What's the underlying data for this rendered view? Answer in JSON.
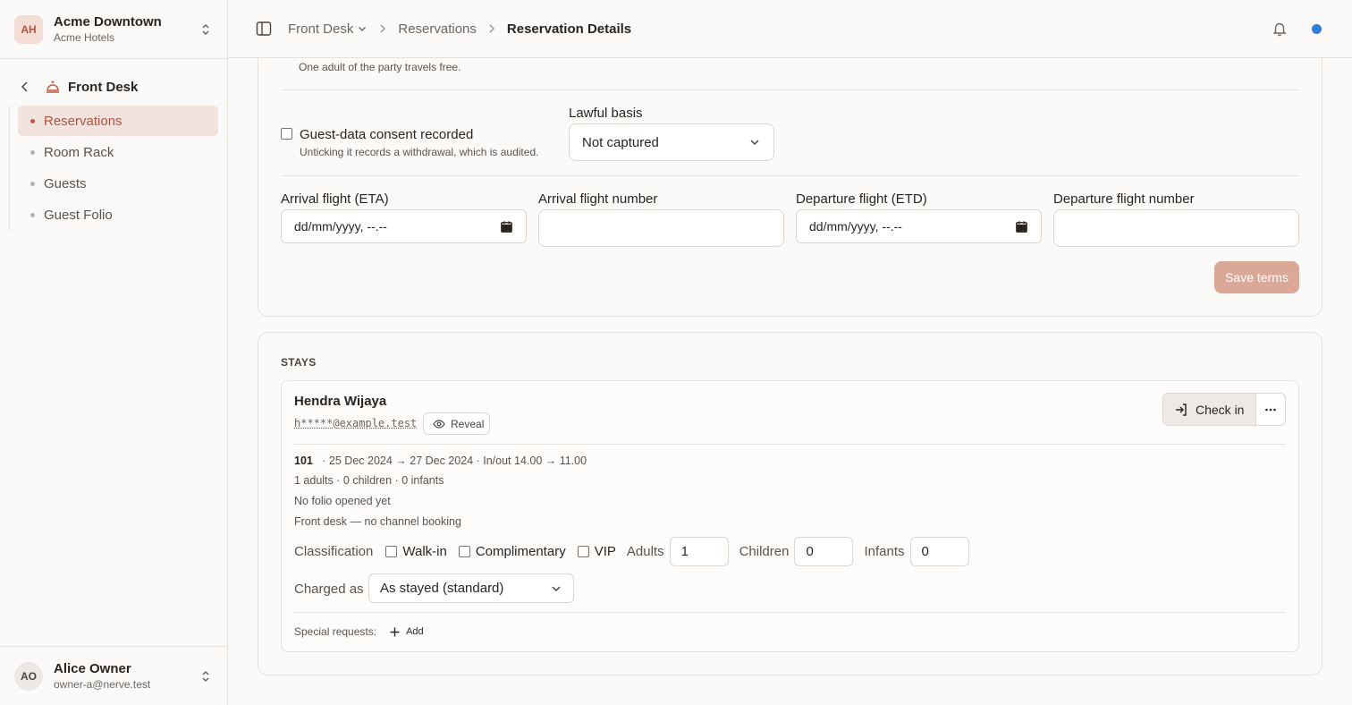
{
  "org": {
    "initials": "AH",
    "name": "Acme Downtown",
    "sub": "Acme Hotels"
  },
  "sidebar": {
    "section_title": "Front Desk",
    "items": [
      {
        "label": "Reservations",
        "active": true
      },
      {
        "label": "Room Rack"
      },
      {
        "label": "Guests"
      },
      {
        "label": "Guest Folio"
      }
    ]
  },
  "user": {
    "initials": "AO",
    "name": "Alice Owner",
    "email": "owner-a@nerve.test"
  },
  "header": {
    "crumb_1": "Front Desk",
    "crumb_2": "Reservations",
    "crumb_3": "Reservation Details"
  },
  "terms": {
    "party_note": "One adult of the party travels free.",
    "consent_label": "Guest-data consent recorded",
    "consent_sub": "Unticking it records a withdrawal, which is audited.",
    "lawful_basis_label": "Lawful basis",
    "lawful_basis_value": "Not captured",
    "arrival_eta_label": "Arrival flight (ETA)",
    "arrival_eta_value": "dd/mm/yyyy, --.--",
    "arrival_flight_label": "Arrival flight number",
    "departure_etd_label": "Departure flight (ETD)",
    "departure_etd_value": "dd/mm/yyyy, --.--",
    "departure_flight_label": "Departure flight number",
    "save_label": "Save terms"
  },
  "stays": {
    "title": "STAYS",
    "guest_name": "Hendra Wijaya",
    "email_masked": "h*****@example.test",
    "reveal_label": "Reveal",
    "checkin_label": "Check in",
    "room": "101",
    "dates": "·   25 Dec 2024 → 27 Dec 2024   ·   In/out 14.00 → 11.00",
    "occupancy": "1 adults · 0 children · 0 infants",
    "folio": "No folio opened yet",
    "channel": "Front desk — no channel booking",
    "classification_label": "Classification",
    "walkin_label": "Walk-in",
    "comp_label": "Complimentary",
    "vip_label": "VIP",
    "adults_label": "Adults",
    "adults_value": "1",
    "children_label": "Children",
    "children_value": "0",
    "infants_label": "Infants",
    "infants_value": "0",
    "charged_label": "Charged as",
    "charged_value": "As stayed (standard)",
    "special_label": "Special requests:",
    "add_label": "Add"
  },
  "colors": {
    "accent": "#c1583f",
    "active_bg": "#f3e3de",
    "save_disabled": "#dba898",
    "notification": "#2e7fe0"
  }
}
